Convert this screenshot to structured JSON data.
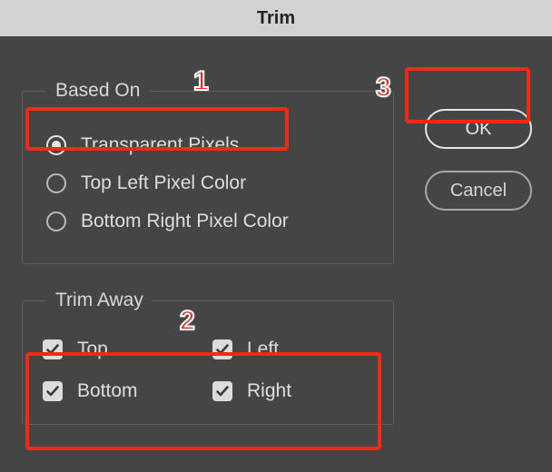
{
  "title": "Trim",
  "basedOn": {
    "legend": "Based On",
    "options": {
      "transparent": "Transparent Pixels",
      "topLeft": "Top Left Pixel Color",
      "bottomRight": "Bottom Right Pixel Color"
    },
    "selected": "transparent"
  },
  "trimAway": {
    "legend": "Trim Away",
    "options": {
      "top": "Top",
      "left": "Left",
      "bottom": "Bottom",
      "right": "Right"
    },
    "checked": {
      "top": true,
      "left": true,
      "bottom": true,
      "right": true
    }
  },
  "buttons": {
    "ok": "OK",
    "cancel": "Cancel"
  },
  "annotations": {
    "n1": "1",
    "n2": "2",
    "n3": "3"
  }
}
